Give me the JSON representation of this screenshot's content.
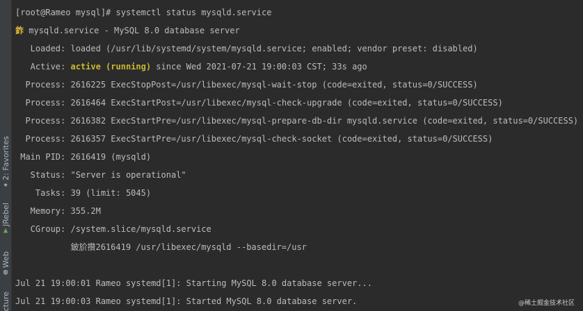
{
  "sidebar": {
    "favorites": "2: Favorites",
    "jrebel": "JRebel",
    "web": "Web",
    "structure": "cture"
  },
  "terminal": {
    "prompt": "[root@Rameo mysql]# systemctl status mysqld.service",
    "unit_dot": "鈼",
    "unit_title": " mysqld.service - MySQL 8.0 database server",
    "loaded": "   Loaded: loaded (/usr/lib/systemd/system/mysqld.service; enabled; vendor preset: disabled)",
    "active_prefix": "   Active: ",
    "active_state": "active (running)",
    "active_suffix": " since Wed 2021-07-21 19:00:03 CST; 33s ago",
    "process1": "  Process: 2616225 ExecStopPost=/usr/libexec/mysql-wait-stop (code=exited, status=0/SUCCESS)",
    "process2": "  Process: 2616464 ExecStartPost=/usr/libexec/mysql-check-upgrade (code=exited, status=0/SUCCESS)",
    "process3": "  Process: 2616382 ExecStartPre=/usr/libexec/mysql-prepare-db-dir mysqld.service (code=exited, status=0/SUCCESS)",
    "process4": "  Process: 2616357 ExecStartPre=/usr/libexec/mysql-check-socket (code=exited, status=0/SUCCESS)",
    "main_pid": " Main PID: 2616419 (mysqld)",
    "status": "   Status: \"Server is operational\"",
    "tasks": "    Tasks: 39 (limit: 5045)",
    "memory": "   Memory: 355.2M",
    "cgroup": "   CGroup: /system.slice/mysqld.service",
    "cgroup_child": "           鈹斺攢2616419 /usr/libexec/mysqld --basedir=/usr",
    "log1": "Jul 21 19:00:01 Rameo systemd[1]: Starting MySQL 8.0 database server...",
    "log2": "Jul 21 19:00:03 Rameo systemd[1]: Started MySQL 8.0 database server."
  },
  "watermark": "@稀土掘金技术社区",
  "colors": {
    "background": "#2b2b2b",
    "text": "#bcbcbc",
    "active_state": "#c9b92e",
    "dot": "#e2b93b"
  }
}
